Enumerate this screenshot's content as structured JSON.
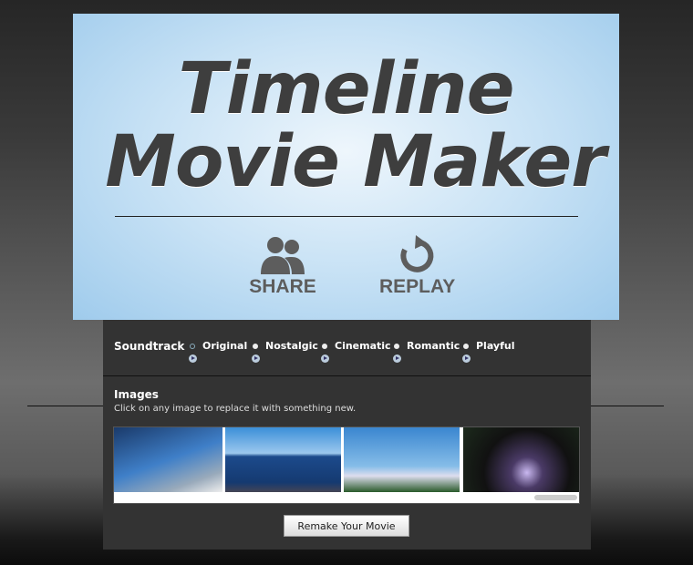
{
  "hero": {
    "title_line1": "Timeline",
    "title_line2": "Movie Maker",
    "share_label": "SHARE",
    "replay_label": "REPLAY"
  },
  "soundtrack": {
    "label": "Soundtrack",
    "options": [
      {
        "label": "Original",
        "selected": true
      },
      {
        "label": "Nostalgic"
      },
      {
        "label": "Cinematic"
      },
      {
        "label": "Romantic"
      },
      {
        "label": "Playful"
      }
    ]
  },
  "images": {
    "heading": "Images",
    "hint": "Click on any image to replace it with something new."
  },
  "remake_label": "Remake Your Movie",
  "colors": {
    "panel": "#333333",
    "hero_blue": "#9fcbec"
  }
}
